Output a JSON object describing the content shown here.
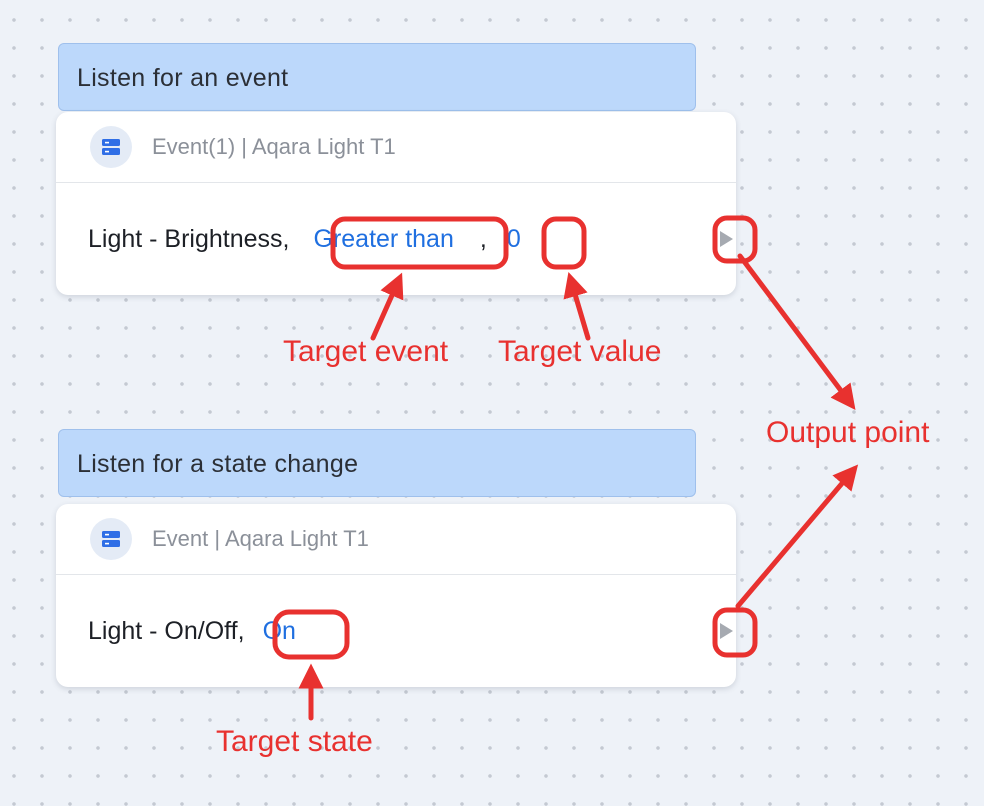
{
  "block1": {
    "header": "Listen for an event",
    "device": "Event(1) | Aqara Light T1",
    "property": "Light - Brightness,",
    "condition": "Greater than",
    "separator": ",",
    "value": "0"
  },
  "block2": {
    "header": "Listen for a state change",
    "device": "Event | Aqara Light T1",
    "property": "Light - On/Off,",
    "state": "On"
  },
  "annotations": {
    "target_event": "Target event",
    "target_value": "Target value",
    "output_point": "Output point",
    "target_state": "Target state"
  },
  "colors": {
    "annotation": "#e8312f",
    "link_value": "#1f6fe0",
    "header_bg": "#bcd8fb",
    "device_icon": "#2f6ee6"
  },
  "icons": {
    "device": "device-server-icon",
    "output": "play-triangle-icon"
  }
}
